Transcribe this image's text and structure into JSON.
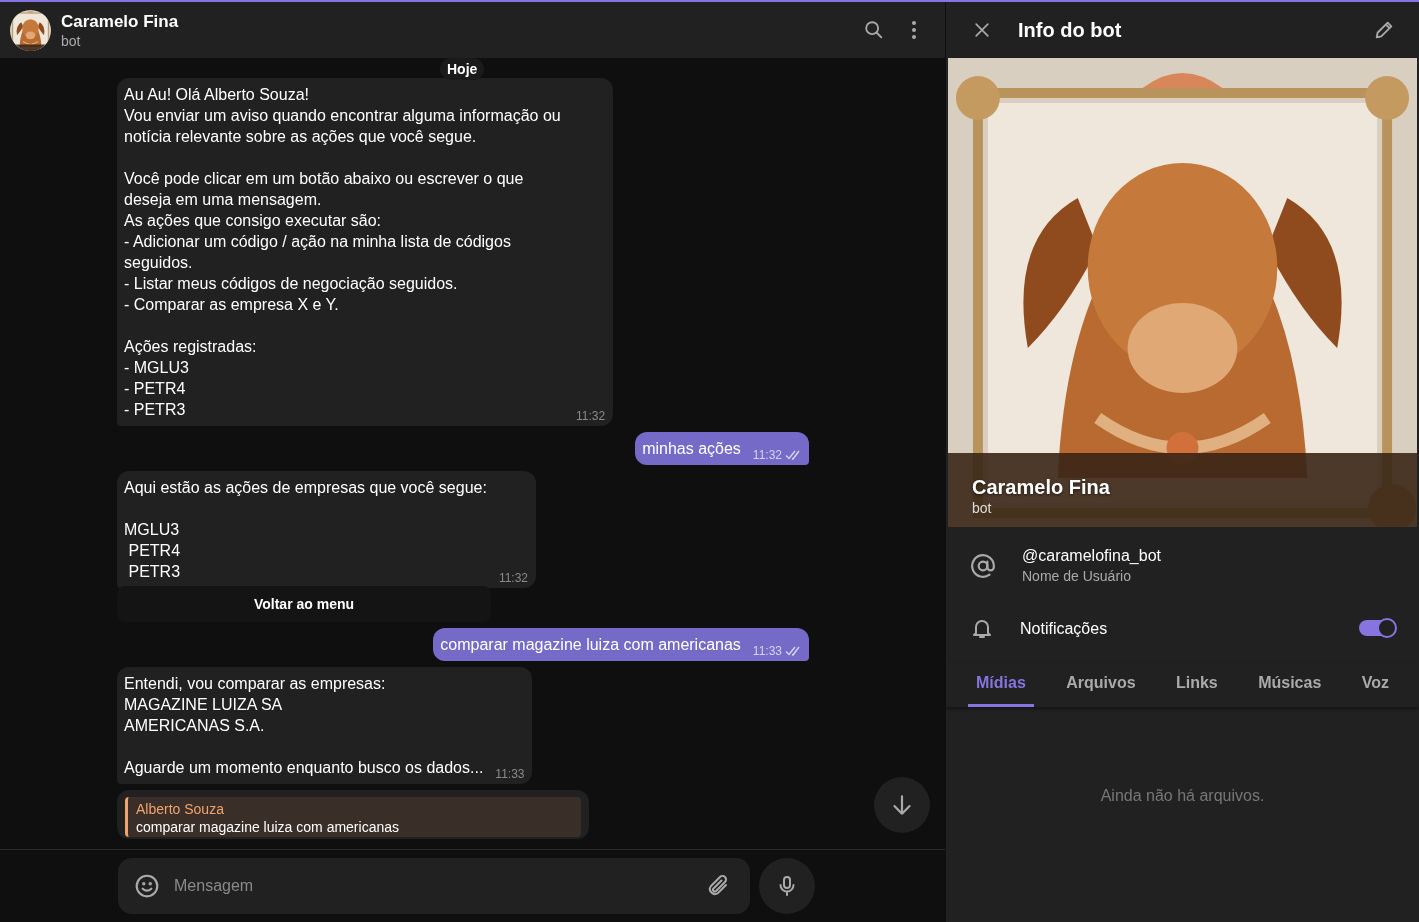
{
  "header": {
    "name": "Caramelo Fina",
    "status": "bot"
  },
  "date_badge": "Hoje",
  "messages": [
    {
      "kind": "incoming",
      "text": "Au Au! Olá Alberto Souza!\nVou enviar um aviso quando encontrar alguma informação ou notícia relevante sobre as ações que você segue.\n\nVocê pode clicar em um botão abaixo ou escrever o que deseja em uma mensagem.\nAs ações que consigo executar são:\n- Adicionar um código / ação na minha lista de códigos seguidos.\n- Listar meus códigos de negociação seguidos.\n- Comparar as empresa X e Y.\n\nAções registradas:\n- MGLU3\n- PETR4\n- PETR3",
      "time": "11:32"
    },
    {
      "kind": "outgoing",
      "text": "minhas ações",
      "time": "11:32",
      "read": true
    },
    {
      "kind": "incoming",
      "text": "Aqui estão as ações de empresas que você segue:\n\nMGLU3\n PETR4\n PETR3",
      "time": "11:32",
      "buttons": [
        "Voltar ao menu"
      ]
    },
    {
      "kind": "outgoing",
      "text": "comparar magazine luiza com americanas",
      "time": "11:33",
      "read": true
    },
    {
      "kind": "incoming",
      "text": "Entendi, vou comparar as empresas:\nMAGAZINE LUIZA SA\nAMERICANAS S.A.\n\nAguarde um momento enquanto busco os dados...",
      "time": "11:33"
    },
    {
      "kind": "reply",
      "reply_to": {
        "author": "Alberto Souza",
        "text": "comparar magazine luiza com americanas"
      }
    }
  ],
  "composer": {
    "placeholder": "Mensagem"
  },
  "info_panel": {
    "title": "Info do bot",
    "name": "Caramelo Fina",
    "status": "bot",
    "username": "@caramelofina_bot",
    "username_label": "Nome de Usuário",
    "notifications_label": "Notificações",
    "notifications_on": true,
    "tabs": [
      {
        "label": "Mídias",
        "selected": true
      },
      {
        "label": "Arquivos",
        "selected": false
      },
      {
        "label": "Links",
        "selected": false
      },
      {
        "label": "Músicas",
        "selected": false
      },
      {
        "label": "Voz",
        "selected": false
      }
    ],
    "empty_text": "Ainda não há arquivos."
  }
}
